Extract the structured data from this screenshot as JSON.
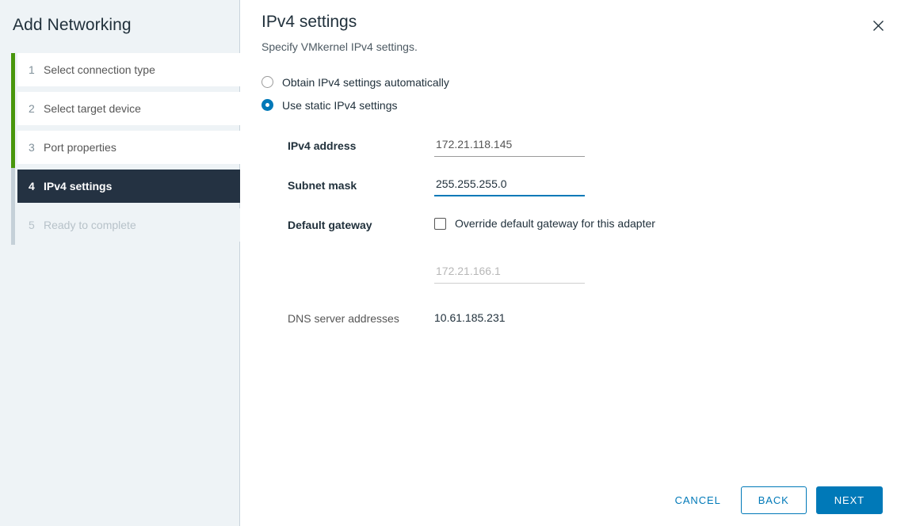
{
  "wizard": {
    "title": "Add Networking",
    "steps": [
      {
        "num": "1",
        "label": "Select connection type",
        "state": "done"
      },
      {
        "num": "2",
        "label": "Select target device",
        "state": "done"
      },
      {
        "num": "3",
        "label": "Port properties",
        "state": "done"
      },
      {
        "num": "4",
        "label": "IPv4 settings",
        "state": "current"
      },
      {
        "num": "5",
        "label": "Ready to complete",
        "state": "upcoming"
      }
    ]
  },
  "page": {
    "title": "IPv4 settings",
    "subtitle": "Specify VMkernel IPv4 settings.",
    "close_icon": "close-icon"
  },
  "options": {
    "automatic": {
      "label": "Obtain IPv4 settings automatically",
      "selected": false
    },
    "static": {
      "label": "Use static IPv4 settings",
      "selected": true
    }
  },
  "fields": {
    "ipv4_address": {
      "label": "IPv4 address",
      "value": "172.21.118.145",
      "placeholder": "IPv4 address",
      "focused": false
    },
    "subnet_mask": {
      "label": "Subnet mask",
      "value": "255.255.255.0",
      "placeholder": "Subnet mask",
      "focused": true
    },
    "default_gateway": {
      "label": "Default gateway",
      "override_label": "Override default gateway for this adapter",
      "override_checked": false,
      "value": "172.21.166.1",
      "placeholder": "172.21.166.1",
      "disabled": true
    },
    "dns_servers": {
      "label": "DNS server addresses",
      "value": "10.61.185.231"
    }
  },
  "footer": {
    "cancel_label": "CANCEL",
    "back_label": "BACK",
    "next_label": "NEXT"
  },
  "colors": {
    "accent": "#0079b8",
    "progress_done": "#48960c",
    "progress_pending": "#c5d0d8",
    "current_step_bg": "#243242",
    "sidebar_bg": "#eef3f6"
  }
}
